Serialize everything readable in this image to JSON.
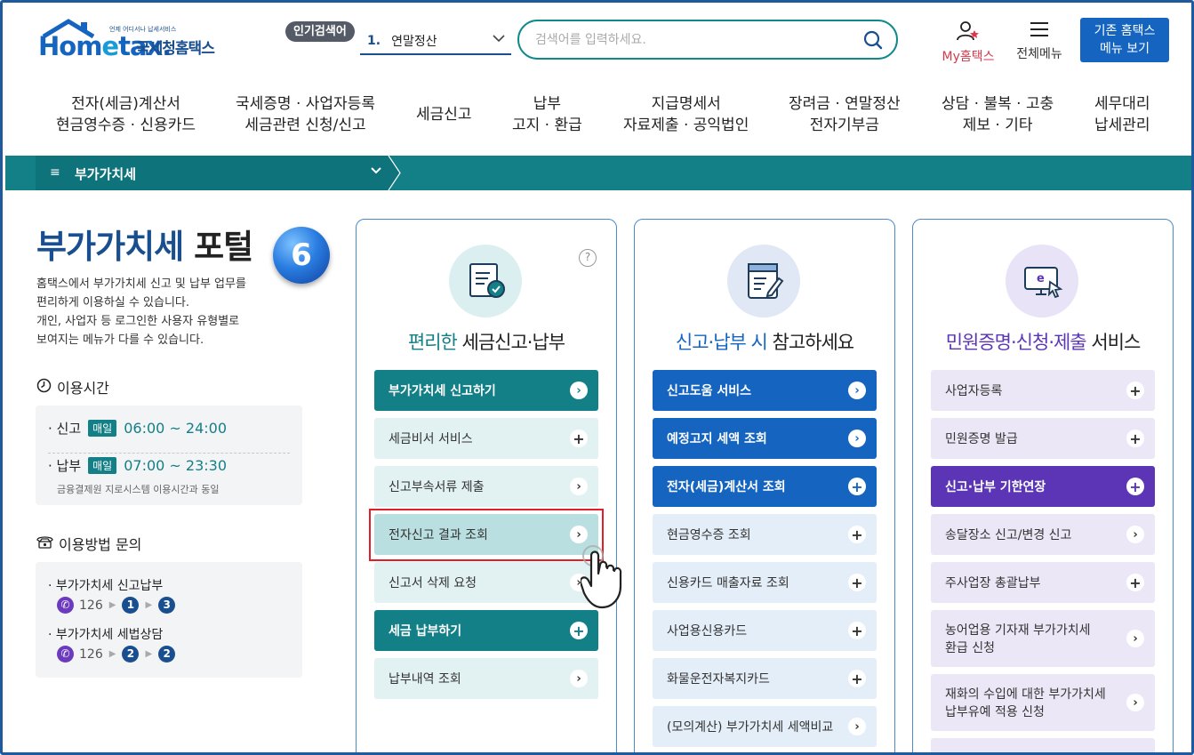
{
  "header": {
    "logo_tiny": "언제 어디서나 납세서비스",
    "logo_main_a": "Hom",
    "logo_main_b": "e",
    "logo_main_c": "tax.",
    "logo_sub": "국세청홈택스",
    "popular_badge": "인기검색어",
    "popular_num": "1.",
    "popular_term": "연말정산",
    "search_placeholder": "검색어를 입력하세요.",
    "myhome_label": "My홈택스",
    "allmenu_label": "전체메뉴",
    "old_menu_line1": "기존 홈택스",
    "old_menu_line2": "메뉴 보기"
  },
  "gnb": [
    {
      "line1": "전자(세금)계산서",
      "line2": "현금영수증 · 신용카드"
    },
    {
      "line1": "국세증명 · 사업자등록",
      "line2": "세금관련 신청/신고"
    },
    {
      "line1": "세금신고",
      "line2": ""
    },
    {
      "line1": "납부",
      "line2": "고지 · 환급"
    },
    {
      "line1": "지급명세서",
      "line2": "자료제출 · 공익법인"
    },
    {
      "line1": "장려금 · 연말정산",
      "line2": "전자기부금"
    },
    {
      "line1": "상담 · 불복 · 고충",
      "line2": "제보 · 기타"
    },
    {
      "line1": "세무대리",
      "line2": "납세관리"
    }
  ],
  "location": {
    "label": "부가가치세"
  },
  "intro": {
    "title_a": "부가가치세",
    "title_b": " 포털",
    "step": "6",
    "desc_1": "홈택스에서 부가가치세 신고 및 납부 업무를",
    "desc_2": "편리하게 이용하실 수 있습니다.",
    "desc_3": "개인, 사업자 등 로그인한 사용자 유형별로",
    "desc_4": "보여지는 메뉴가 다를 수 있습니다.",
    "hours_title": "이용시간",
    "hours": [
      {
        "label": "· 신고",
        "chip": "매일",
        "time": "06:00 ~ 24:00"
      },
      {
        "label": "· 납부",
        "chip": "매일",
        "time": "07:00 ~ 23:30"
      }
    ],
    "hours_note": "금융결제원 지로시스템 이용시간과 동일",
    "inquiry_title": "이용방법 문의",
    "inquiries": [
      {
        "label": "· 부가가치세 신고납부",
        "phone": "126",
        "s1": "1",
        "s2": "3"
      },
      {
        "label": "· 부가가치세 세법상담",
        "phone": "126",
        "s1": "2",
        "s2": "2"
      }
    ]
  },
  "cards": [
    {
      "title_a": "편리한",
      "title_b": " 세금신고·납부",
      "help": "?",
      "buttons": [
        {
          "label": "부가가치세 신고하기"
        },
        {
          "label": "세금비서 서비스"
        },
        {
          "label": "신고부속서류 제출"
        },
        {
          "label": "전자신고 결과 조회"
        },
        {
          "label": "신고서 삭제 요청"
        },
        {
          "label": "세금 납부하기"
        },
        {
          "label": "납부내역 조회"
        }
      ]
    },
    {
      "title_a": "신고·납부 시",
      "title_b": " 참고하세요",
      "buttons": [
        {
          "label": "신고도움 서비스"
        },
        {
          "label": "예정고지 세액 조회"
        },
        {
          "label": "전자(세금)계산서 조회"
        },
        {
          "label": "현금영수증 조회"
        },
        {
          "label": "신용카드 매출자료 조회"
        },
        {
          "label": "사업용신용카드"
        },
        {
          "label": "화물운전자복지카드"
        },
        {
          "label": "(모의계산) 부가가치세 세액비교"
        }
      ]
    },
    {
      "title_a": "민원증명·신청·제출",
      "title_b": " 서비스",
      "buttons": [
        {
          "label": "사업자등록"
        },
        {
          "label": "민원증명 발급"
        },
        {
          "label": "신고·납부 기한연장"
        },
        {
          "label": "송달장소 신고/변경 신고"
        },
        {
          "label": "주사업장 총괄납부"
        },
        {
          "label": "농어업용 기자재 부가가치세",
          "label2": "환급 신청"
        },
        {
          "label": "재화의 수입에 대한 부가가치세",
          "label2": "납부유예 적용 신청"
        }
      ]
    }
  ],
  "colors": {
    "teal": "#137f87",
    "navy": "#1a4f8f",
    "blue": "#1565c0",
    "purple": "#5b35b5",
    "highlight": "#e01f26"
  }
}
